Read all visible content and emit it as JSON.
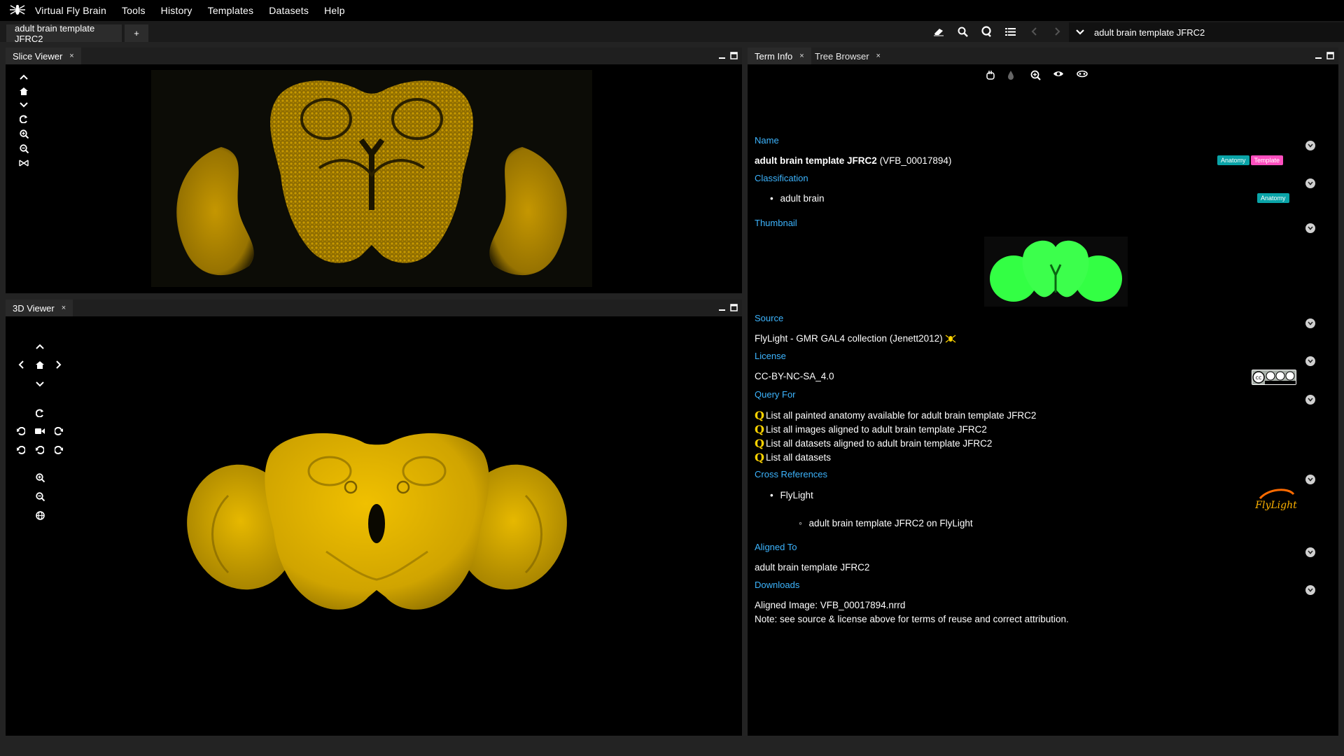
{
  "menubar": {
    "items": [
      "Virtual Fly Brain",
      "Tools",
      "History",
      "Templates",
      "Datasets",
      "Help"
    ]
  },
  "tabs": {
    "active_label": "adult brain template JFRC2",
    "add_label": "+"
  },
  "instance_select": {
    "value": "adult brain template JFRC2"
  },
  "slice_viewer": {
    "tab_label": "Slice Viewer",
    "close": "×"
  },
  "viewer3d": {
    "tab_label": "3D Viewer",
    "close": "×"
  },
  "term_info": {
    "tab_label": "Term Info",
    "tab2_label": "Tree Browser",
    "close": "×",
    "sections": {
      "name": {
        "title": "Name",
        "term": "adult brain template JFRC2",
        "id": "(VFB_00017894)",
        "badges": [
          "Anatomy",
          "Template"
        ]
      },
      "classification": {
        "title": "Classification",
        "items": [
          "adult brain"
        ],
        "badge": "Anatomy"
      },
      "thumbnail": {
        "title": "Thumbnail"
      },
      "source": {
        "title": "Source",
        "text": "FlyLight - GMR GAL4 collection (Jenett2012)"
      },
      "license": {
        "title": "License",
        "text": "CC-BY-NC-SA_4.0"
      },
      "query_for": {
        "title": "Query For",
        "items": [
          "List all painted anatomy available for adult brain template JFRC2",
          "List all images aligned to adult brain template JFRC2",
          "List all datasets aligned to adult brain template JFRC2",
          "List all datasets"
        ]
      },
      "cross_references": {
        "title": "Cross References",
        "item": "FlyLight",
        "subitem": "adult brain template JFRC2 on FlyLight",
        "logo_text": "FlyLight"
      },
      "aligned_to": {
        "title": "Aligned To",
        "text": "adult brain template JFRC2"
      },
      "downloads": {
        "title": "Downloads",
        "line1": "Aligned Image: VFB_00017894.nrrd",
        "line2": "Note: see source & license above for terms of reuse and correct attribution."
      }
    }
  },
  "colors": {
    "brain_yellow": "#e0b000",
    "thumbnail_green": "#33ff44",
    "section_blue": "#3db5ff",
    "badge_teal": "#0aa4a8",
    "badge_pink": "#ff4fc0"
  }
}
